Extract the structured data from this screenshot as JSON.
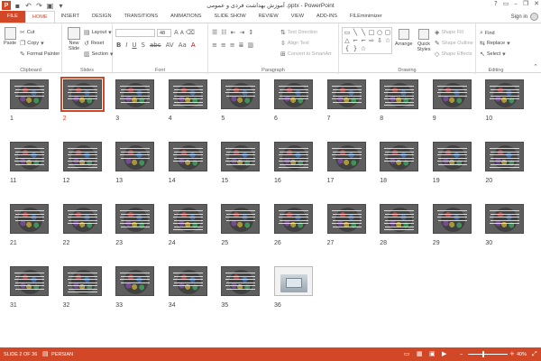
{
  "window": {
    "title": "آموزش بهداشت فردی و عمومی .pptx - PowerPoint",
    "app_logo": "P",
    "controls": [
      "?",
      "▭",
      "–",
      "❐",
      "✕"
    ]
  },
  "tabs": [
    "FILE",
    "HOME",
    "INSERT",
    "DESIGN",
    "TRANSITIONS",
    "ANIMATIONS",
    "SLIDE SHOW",
    "REVIEW",
    "VIEW",
    "ADD-INS",
    "FILEminimizer"
  ],
  "active_tab": "HOME",
  "account": {
    "sign_in": "Sign in"
  },
  "ribbon": {
    "clipboard": {
      "label": "Clipboard",
      "paste": "Paste",
      "cut": "Cut",
      "copy": "Copy",
      "format_painter": "Format Painter"
    },
    "slides": {
      "label": "Slides",
      "new_slide": "New Slide",
      "layout": "Layout",
      "reset": "Reset",
      "section": "Section"
    },
    "font": {
      "label": "Font",
      "font_name": "",
      "font_size": "48"
    },
    "paragraph": {
      "label": "Paragraph",
      "text_direction": "Text Direction",
      "align_text": "Align Text",
      "convert_smartart": "Convert to SmartArt"
    },
    "drawing": {
      "label": "Drawing",
      "arrange": "Arrange",
      "quick_styles": "Quick Styles",
      "shape_fill": "Shape Fill",
      "shape_outline": "Shape Outline",
      "shape_effects": "Shape Effects"
    },
    "editing": {
      "label": "Editing",
      "find": "Find",
      "replace": "Replace",
      "select": "Select"
    }
  },
  "slides": {
    "count": 36,
    "selected": 2,
    "labels": [
      "1",
      "2",
      "3",
      "4",
      "5",
      "6",
      "7",
      "8",
      "9",
      "10",
      "11",
      "12",
      "13",
      "14",
      "15",
      "16",
      "17",
      "18",
      "19",
      "20",
      "21",
      "22",
      "23",
      "24",
      "25",
      "26",
      "27",
      "28",
      "29",
      "30",
      "31",
      "32",
      "33",
      "34",
      "35",
      "36"
    ]
  },
  "status": {
    "slide_info": "SLIDE 2 OF 36",
    "language": "PERSIAN",
    "zoom": "40%",
    "zoom_percent": 40
  },
  "colors": {
    "accent": "#d24726",
    "slide_bg": "#5e5e5e"
  }
}
